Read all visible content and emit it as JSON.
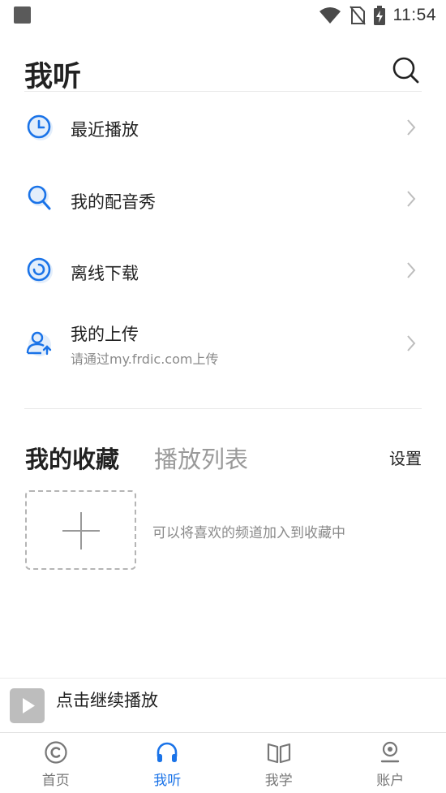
{
  "status_bar": {
    "time": "11:54",
    "icons": [
      "notification-square-icon",
      "wifi-icon",
      "no-sim-icon",
      "battery-charging-icon"
    ]
  },
  "header": {
    "title": "我听",
    "search_icon": "search-icon"
  },
  "menu": {
    "items": [
      {
        "label": "最近播放",
        "sub": "",
        "icon": "clock-icon"
      },
      {
        "label": "我的配音秀",
        "sub": "",
        "icon": "magnifier-icon"
      },
      {
        "label": "离线下载",
        "sub": "",
        "icon": "download-ring-icon"
      },
      {
        "label": "我的上传",
        "sub": "请通过my.frdic.com上传",
        "icon": "user-upload-icon"
      }
    ]
  },
  "favorites": {
    "tab_favorites": "我的收藏",
    "tab_playlist": "播放列表",
    "settings": "设置",
    "hint": "可以将喜欢的频道加入到收藏中"
  },
  "mini_player": {
    "label": "点击继续播放"
  },
  "tabbar": {
    "items": [
      {
        "label": "首页",
        "icon": "home-c-icon",
        "active": false
      },
      {
        "label": "我听",
        "icon": "headphones-icon",
        "active": true
      },
      {
        "label": "我学",
        "icon": "book-icon",
        "active": false
      },
      {
        "label": "账户",
        "icon": "account-icon",
        "active": false
      }
    ]
  },
  "colors": {
    "accent": "#1a73e8",
    "icon_bg": "#e3eefb",
    "text": "#222222",
    "muted": "#8a8a8a"
  }
}
